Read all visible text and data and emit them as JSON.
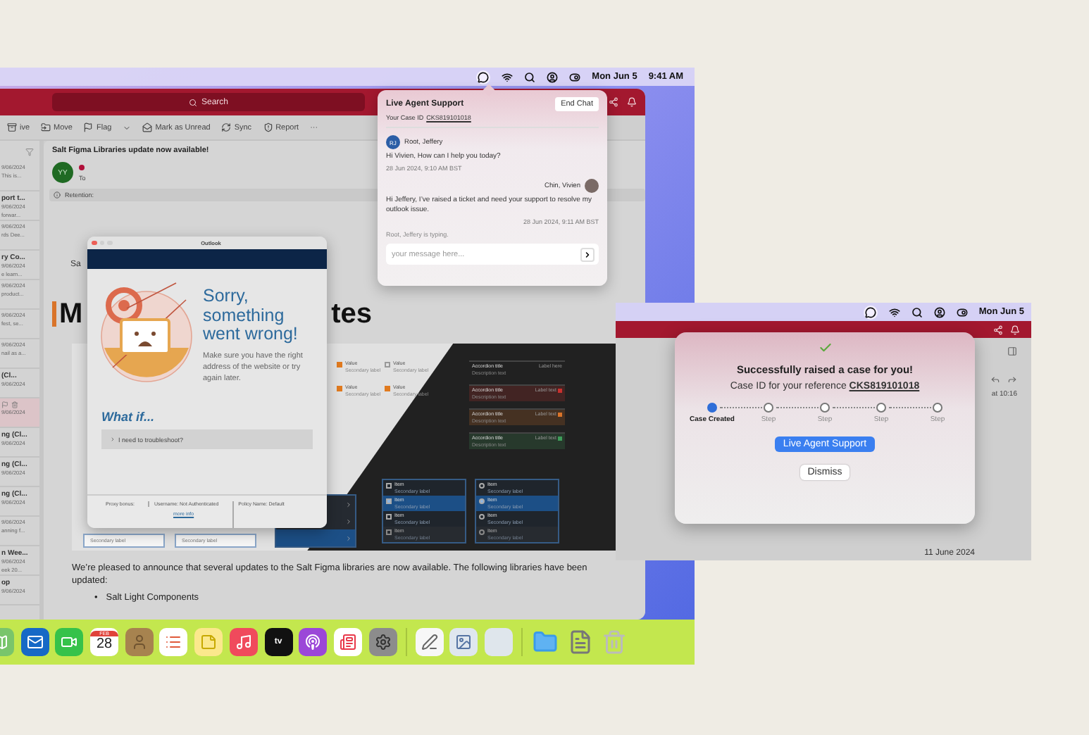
{
  "menubar": {
    "date": "Mon Jun 5",
    "time": "9:41 AM"
  },
  "outlook": {
    "search": {
      "placeholder": "Search"
    },
    "toolbar": [
      {
        "kind": "archive",
        "label": "ive",
        "dropdown": false
      },
      {
        "kind": "move",
        "label": "Move",
        "dropdown": false
      },
      {
        "kind": "flag",
        "label": "Flag",
        "dropdown": true
      },
      {
        "kind": "unread",
        "label": "Mark as Unread",
        "dropdown": false
      },
      {
        "kind": "sync",
        "label": "Sync",
        "dropdown": false
      },
      {
        "kind": "report",
        "label": "Report",
        "dropdown": false
      },
      {
        "kind": "more",
        "label": "···",
        "dropdown": false
      }
    ],
    "messages": [
      {
        "date": "9/06/2024",
        "preview": "This is...",
        "selected": false
      },
      {
        "title": "port t...",
        "date": "9/06/2024",
        "preview": "forwar...",
        "selected": false
      },
      {
        "date": "9/06/2024",
        "preview": "rds Dee...",
        "selected": false
      },
      {
        "title": "ry Co...",
        "date": "9/06/2024",
        "preview": "e learn...",
        "selected": false
      },
      {
        "date": "9/06/2024",
        "preview": "product...",
        "selected": false
      },
      {
        "date": "9/06/2024",
        "preview": "fest, se...",
        "selected": false
      },
      {
        "date": "9/06/2024",
        "preview": "nail as a...",
        "selected": false
      },
      {
        "title": "(Cl...",
        "date": "9/06/2024",
        "selected": false
      },
      {
        "date": "9/06/2024",
        "selected": true
      },
      {
        "title": "ng (Cl...",
        "date": "9/06/2024",
        "selected": false
      },
      {
        "title": "ng (Cl...",
        "date": "9/06/2024",
        "selected": false
      },
      {
        "title": "ng (Cl...",
        "date": "9/06/2024",
        "selected": false
      },
      {
        "date": "9/06/2024",
        "preview": "anning f...",
        "selected": false
      },
      {
        "title": "n Wee...",
        "date": "9/06/2024",
        "preview": "eek 20...",
        "selected": false
      },
      {
        "title": "op",
        "date": "9/06/2024",
        "selected": false
      }
    ],
    "email": {
      "subject": "Salt Figma Libraries update now available!",
      "avatar": "YY",
      "unread": true,
      "to": "To",
      "retention": "Retention:",
      "salutation": "Sa",
      "heading_start": "M",
      "heading_end": "tes",
      "body": "We’re pleased to announce that several updates to the Salt Figma libraries are now available. The following libraries have been updated:",
      "bullets": [
        {
          "marker": "•",
          "text": "Salt Light Components"
        }
      ]
    },
    "showcase": {
      "values": [
        {
          "label": "Value",
          "secondary": "Secondary label",
          "checked": true
        },
        {
          "label": "Value",
          "secondary": "Secondary label",
          "checked": false
        },
        {
          "label": "Value",
          "secondary": "Secondary label",
          "checked": true
        },
        {
          "label": "Value",
          "secondary": "Secondary label",
          "checked": true
        }
      ],
      "accordions": [
        {
          "title": "Accordion title",
          "description": "Description text",
          "label": "Label here"
        },
        {
          "title": "Accordion title",
          "description": "Description text",
          "label": "Label text",
          "color": "#c9312f"
        },
        {
          "title": "Accordion title",
          "description": "Description text",
          "label": "Label text",
          "color": "#d9742a"
        },
        {
          "title": "Accordion title",
          "description": "Description text",
          "label": "Label text",
          "color": "#3f9c5a"
        }
      ],
      "cards": [
        "Secondary label",
        "Secondary label"
      ],
      "nav_list": [
        {
          "selected": false
        },
        {
          "selected": false
        },
        {
          "selected": true
        }
      ],
      "lists": [
        {
          "kind": "checkbox",
          "items": [
            {
              "title": "Item",
              "secondary": "Secondary label",
              "selected": false,
              "disabled": false
            },
            {
              "title": "Item",
              "secondary": "Secondary label",
              "selected": true,
              "disabled": false
            },
            {
              "title": "Item",
              "secondary": "Secondary label",
              "selected": false,
              "disabled": false
            },
            {
              "title": "Item",
              "secondary": "Secondary label",
              "selected": false,
              "disabled": true
            }
          ]
        },
        {
          "kind": "icon",
          "items": [
            {
              "title": "Item",
              "secondary": "Secondary label",
              "selected": false,
              "disabled": false
            },
            {
              "title": "Item",
              "secondary": "Secondary label",
              "selected": true,
              "disabled": false
            },
            {
              "title": "Item",
              "secondary": "Secondary label",
              "selected": false,
              "disabled": false
            },
            {
              "title": "Item",
              "secondary": "Secondary label",
              "selected": false,
              "disabled": true
            }
          ]
        }
      ]
    }
  },
  "error_dialog": {
    "title": "Outlook",
    "heading": "Sorry, something went wrong!",
    "message": "Make sure you have the right address of the website or try again later.",
    "what_if": "What if...",
    "troubleshoot": "I need to troubleshoot?",
    "footer": [
      "Proxy bonus:",
      "Username: Not Authenticated",
      "Policy Name: Default"
    ],
    "footer_link": "more info"
  },
  "chat": {
    "title": "Live Agent Support",
    "end_button": "End Chat",
    "case_label": "Your Case ID",
    "case_id": "CKS819101018",
    "messages": [
      {
        "kind": "agent",
        "author": "Root, Jeffery",
        "avatar": "RJ",
        "text": "Hi Vivien, How can I help you today?",
        "time": "28 Jun 2024, 9:10 AM BST"
      },
      {
        "kind": "user",
        "author": "Chin, Vivien",
        "text": "Hi Jeffery, I’ve raised a ticket and need your support to resolve my outlook issue.",
        "time": "28 Jun 2024, 9:11 AM BST"
      }
    ],
    "typing": "Root, Jeffery is typing.",
    "input": {
      "placeholder": "your message here..."
    }
  },
  "dock": [
    [
      {
        "kind": "maps"
      },
      {
        "kind": "mail"
      },
      {
        "kind": "video"
      },
      {
        "kind": "calendar",
        "month": "FEB",
        "day": "28"
      },
      {
        "kind": "contacts"
      },
      {
        "kind": "reminders"
      },
      {
        "kind": "notes"
      },
      {
        "kind": "music"
      },
      {
        "kind": "tv",
        "label": "tv"
      },
      {
        "kind": "podcasts"
      },
      {
        "kind": "news"
      },
      {
        "kind": "settings"
      }
    ],
    [
      {
        "kind": "textedit"
      },
      {
        "kind": "preview"
      },
      {
        "kind": "blank"
      }
    ],
    [
      {
        "kind": "folder"
      },
      {
        "kind": "document"
      },
      {
        "kind": "trash"
      }
    ]
  ],
  "case_screen": {
    "menubar": {
      "date": "Mon Jun 5"
    },
    "time": "at 10:16",
    "date": "11 June 2024",
    "dialog": {
      "title": "Successfully raised a case for you!",
      "reference_label": "Case ID for your reference",
      "case_id": "CKS819101018",
      "steps": [
        {
          "label": "Case Created",
          "selected": true
        },
        {
          "label": "Step",
          "selected": false
        },
        {
          "label": "Step",
          "selected": false
        },
        {
          "label": "Step",
          "selected": false
        },
        {
          "label": "Step",
          "selected": false
        }
      ],
      "primary_button": "Live Agent Support",
      "secondary_button": "Dismiss"
    }
  }
}
